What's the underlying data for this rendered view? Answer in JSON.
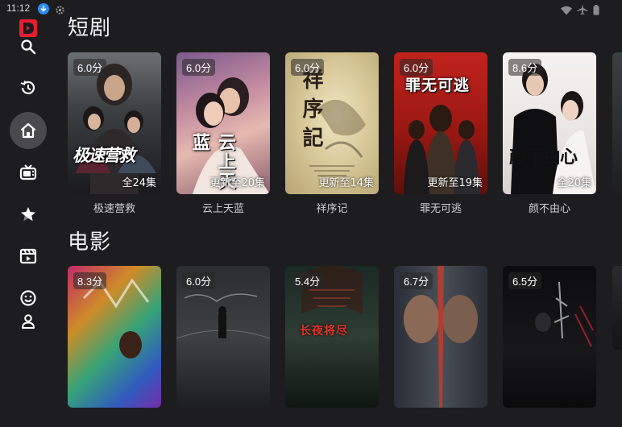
{
  "status": {
    "time": "11:12"
  },
  "sidebar": {
    "icons": [
      "app-logo",
      "search-icon",
      "history-icon",
      "home-icon",
      "tv-icon",
      "star-icon",
      "film-icon",
      "smile-icon",
      "user-icon"
    ],
    "active": "home",
    "accent": "#e5202e"
  },
  "sections": [
    {
      "title": "短剧",
      "items": [
        {
          "name": "极速营救",
          "score": "6.0分",
          "episodes": "全24集",
          "poster_title": "极速营救"
        },
        {
          "name": "云上天蓝",
          "score": "6.0分",
          "episodes": "更新至20集",
          "poster_title": "云上天蓝"
        },
        {
          "name": "祥序记",
          "score": "6.0分",
          "episodes": "更新至14集",
          "poster_title": "祥序記"
        },
        {
          "name": "罪无可逃",
          "score": "6.0分",
          "episodes": "更新至19集",
          "poster_title": "罪无可逃"
        },
        {
          "name": "颜不由心",
          "score": "8.6分",
          "episodes": "全20集",
          "poster_title": "颜不由心"
        }
      ]
    },
    {
      "title": "电影",
      "items": [
        {
          "score": "8.3分"
        },
        {
          "score": "6.0分"
        },
        {
          "score": "5.4分",
          "poster_title": "长夜将尽"
        },
        {
          "score": "6.7分"
        },
        {
          "score": "6.5分"
        }
      ]
    }
  ]
}
